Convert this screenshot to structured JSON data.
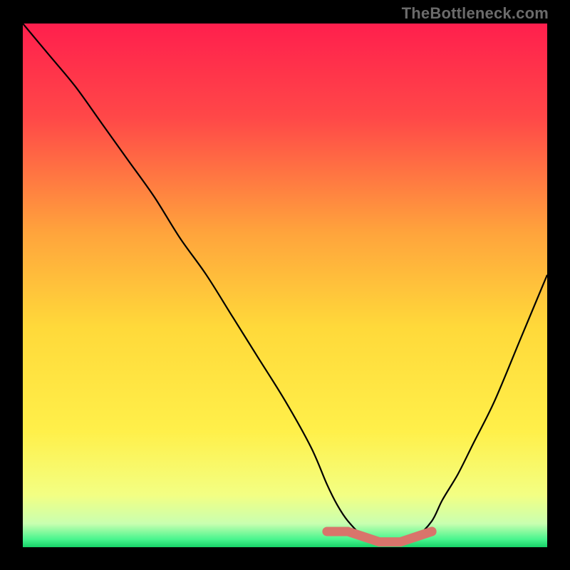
{
  "watermark": "TheBottleneck.com",
  "chart_data": {
    "type": "line",
    "title": "",
    "xlabel": "",
    "ylabel": "",
    "xlim": [
      0,
      100
    ],
    "ylim": [
      0,
      100
    ],
    "series": [
      {
        "name": "bottleneck-curve",
        "x": [
          0,
          5,
          10,
          15,
          20,
          25,
          30,
          35,
          40,
          45,
          50,
          55,
          58,
          60,
          62,
          65,
          68,
          70,
          72,
          75,
          78,
          80,
          83,
          86,
          90,
          95,
          100
        ],
        "y": [
          100,
          94,
          88,
          81,
          74,
          67,
          59,
          52,
          44,
          36,
          28,
          19,
          12,
          8,
          5,
          2,
          1,
          1,
          1,
          2,
          5,
          9,
          14,
          20,
          28,
          40,
          52
        ]
      }
    ],
    "highlight_band": {
      "name": "optimal-range",
      "x_start": 58,
      "x_end": 78,
      "color": "#d9746b"
    },
    "marker": {
      "x": 78,
      "y": 3,
      "color": "#d9746b"
    },
    "gradient_stops": [
      {
        "pos": 0.0,
        "color": "#ff1f4d"
      },
      {
        "pos": 0.18,
        "color": "#ff4848"
      },
      {
        "pos": 0.4,
        "color": "#ffa43c"
      },
      {
        "pos": 0.58,
        "color": "#ffd93a"
      },
      {
        "pos": 0.78,
        "color": "#fff04a"
      },
      {
        "pos": 0.9,
        "color": "#f3ff83"
      },
      {
        "pos": 0.955,
        "color": "#c9ffb0"
      },
      {
        "pos": 0.985,
        "color": "#48f58e"
      },
      {
        "pos": 1.0,
        "color": "#17d268"
      }
    ]
  }
}
